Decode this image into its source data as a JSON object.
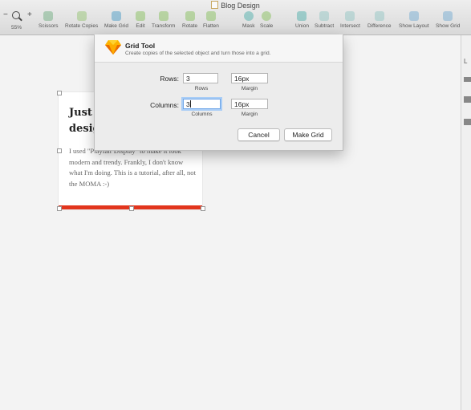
{
  "window": {
    "title": "Blog Design"
  },
  "toolbar": {
    "zoom": {
      "minus": "−",
      "plus": "+",
      "value": "55%"
    },
    "items": [
      {
        "label": "Scissors",
        "icon": "scissors-icon"
      },
      {
        "label": "Rotate Copies",
        "icon": "rotate-copies-icon"
      },
      {
        "label": "Make Grid",
        "icon": "grid-icon"
      },
      {
        "label": "Edit",
        "icon": "edit-icon"
      },
      {
        "label": "Transform",
        "icon": "transform-icon"
      },
      {
        "label": "Rotate",
        "icon": "rotate-icon"
      },
      {
        "label": "Flatten",
        "icon": "flatten-icon"
      },
      {
        "label": "Mask",
        "icon": "mask-icon"
      },
      {
        "label": "Scale",
        "icon": "scale-icon"
      },
      {
        "label": "Union",
        "icon": "union-icon"
      },
      {
        "label": "Subtract",
        "icon": "subtract-icon"
      },
      {
        "label": "Intersect",
        "icon": "intersect-icon"
      },
      {
        "label": "Difference",
        "icon": "difference-icon"
      },
      {
        "label": "Show Layout",
        "icon": "layout-icon"
      },
      {
        "label": "Show Grid",
        "icon": "show-grid-icon"
      }
    ]
  },
  "artboard": {
    "title": "Just p\ndesig",
    "body": "I used \"Playfair Display\" to make it look modern and trendy. Frankly, I don't know what I'm doing. This is a tutorial, after all, not the MOMA :-)",
    "accent": "#e2351d"
  },
  "dialog": {
    "title": "Grid Tool",
    "subtitle": "Create copies of the selected object and turn those into a grid.",
    "rows_label": "Rows:",
    "rows_value": "3",
    "rows_caption": "Rows",
    "rows_margin": "16px",
    "rows_margin_caption": "Margin",
    "columns_label": "Columns:",
    "columns_value": "3",
    "columns_caption": "Columns",
    "columns_margin": "16px",
    "columns_margin_caption": "Margin",
    "cancel": "Cancel",
    "make_grid": "Make Grid"
  },
  "right_panel": {
    "label": "L"
  }
}
